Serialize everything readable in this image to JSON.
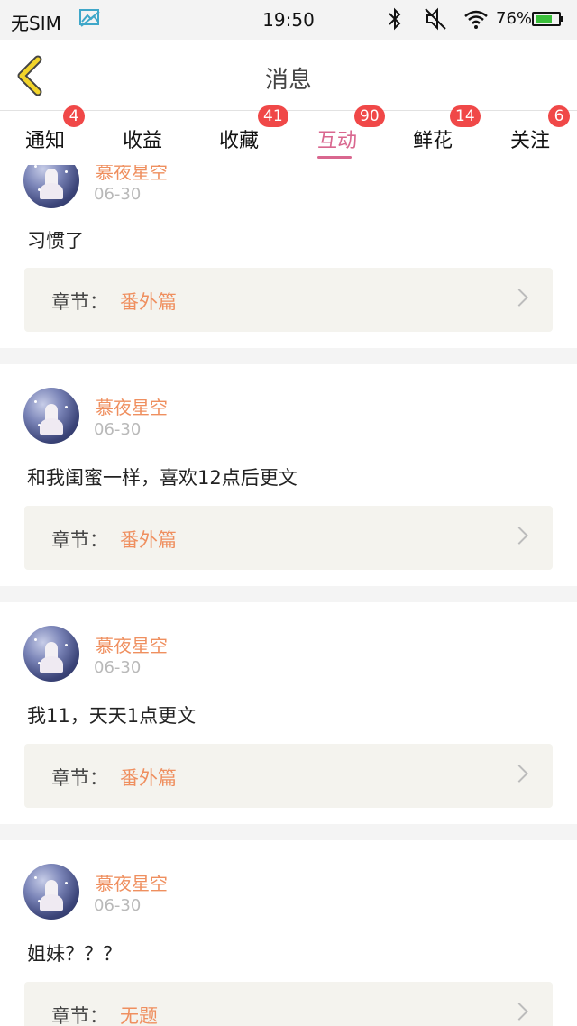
{
  "status_bar": {
    "carrier": "无SIM",
    "time": "19:50",
    "battery": "76%",
    "battery_level": 0.76
  },
  "nav": {
    "title": "消息"
  },
  "tabs": [
    {
      "label": "通知",
      "badge": "4"
    },
    {
      "label": "收益",
      "badge": ""
    },
    {
      "label": "收藏",
      "badge": "41"
    },
    {
      "label": "互动",
      "badge": "90",
      "active": true
    },
    {
      "label": "鲜花",
      "badge": "14"
    },
    {
      "label": "关注",
      "badge": "6"
    }
  ],
  "messages": [
    {
      "username": "慕夜星空",
      "date": "06-30",
      "content": "习惯了",
      "chapter_key": "章节：",
      "chapter_value": "番外篇"
    },
    {
      "username": "慕夜星空",
      "date": "06-30",
      "content": "和我闺蜜一样，喜欢12点后更文",
      "chapter_key": "章节：",
      "chapter_value": "番外篇"
    },
    {
      "username": "慕夜星空",
      "date": "06-30",
      "content": "我11，天天1点更文",
      "chapter_key": "章节：",
      "chapter_value": "番外篇"
    },
    {
      "username": "慕夜星空",
      "date": "06-30",
      "content": "姐妹？？？",
      "chapter_key": "章节：",
      "chapter_value": "无题"
    }
  ],
  "colors": {
    "accent": "#d9678f",
    "username": "#ef8f5f",
    "badge": "#f04848",
    "back_arrow": "#f2d42a"
  },
  "icons": [
    "no-sim",
    "picture-icon",
    "bluetooth-icon",
    "mute-icon",
    "wifi-icon",
    "battery-icon",
    "back-arrow-icon",
    "chevron-right-icon"
  ]
}
